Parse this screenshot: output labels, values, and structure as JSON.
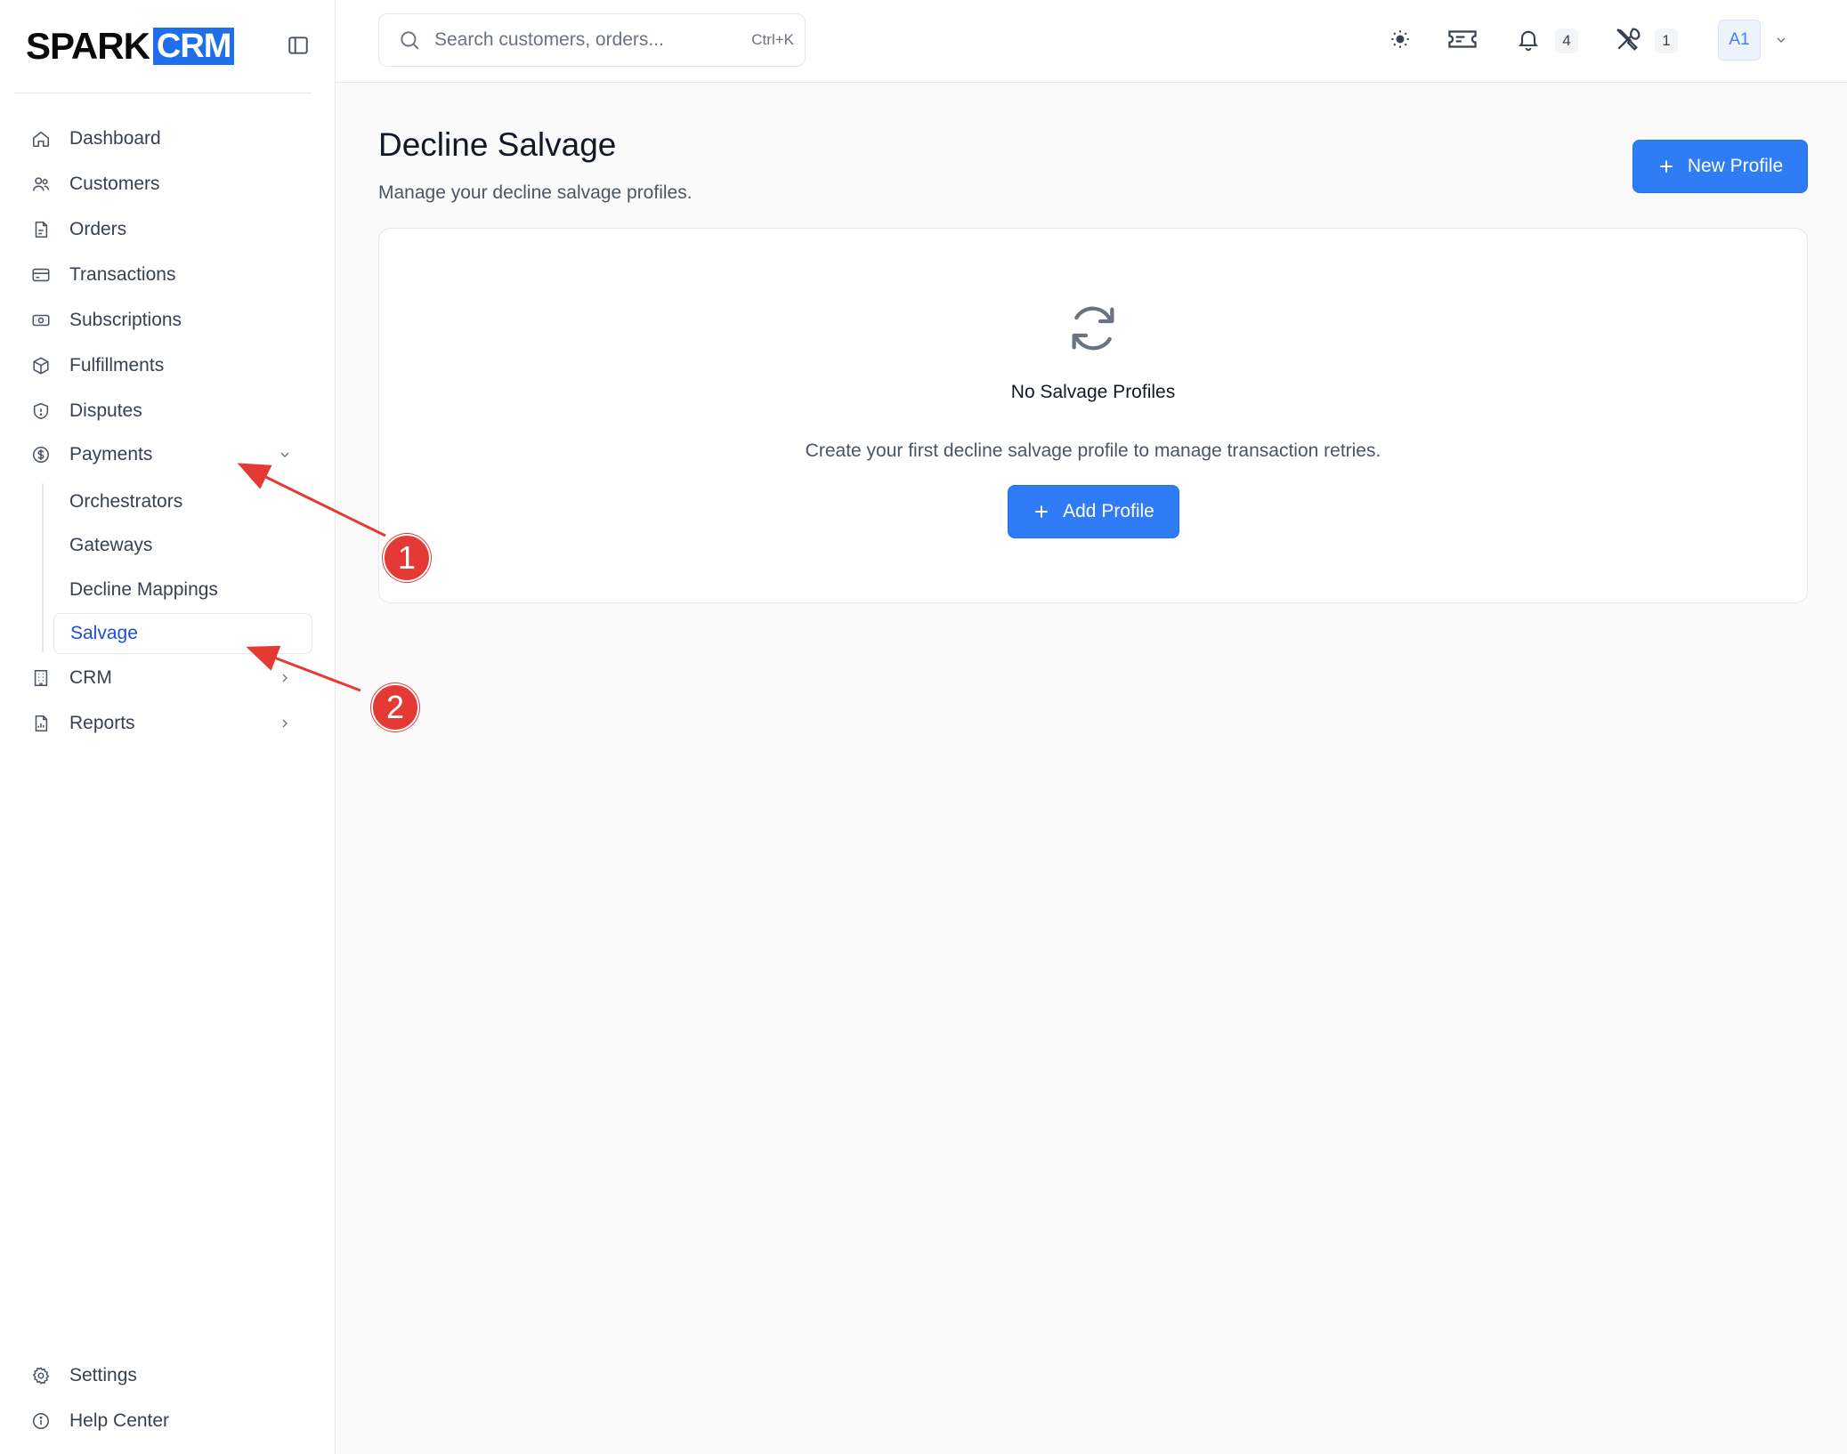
{
  "brand": {
    "part1": "SPARK",
    "part2": "CRM"
  },
  "sidebar": {
    "items": [
      {
        "label": "Dashboard",
        "icon": "home-icon"
      },
      {
        "label": "Customers",
        "icon": "users-icon"
      },
      {
        "label": "Orders",
        "icon": "file-icon"
      },
      {
        "label": "Transactions",
        "icon": "credit-card-icon"
      },
      {
        "label": "Subscriptions",
        "icon": "banknote-icon"
      },
      {
        "label": "Fulfillments",
        "icon": "package-icon"
      },
      {
        "label": "Disputes",
        "icon": "shield-icon"
      },
      {
        "label": "Payments",
        "icon": "dollar-circle-icon",
        "expanded": true
      },
      {
        "label": "CRM",
        "icon": "building-icon"
      },
      {
        "label": "Reports",
        "icon": "report-file-icon"
      }
    ],
    "payments_sub": [
      "Orchestrators",
      "Gateways",
      "Decline Mappings",
      "Salvage"
    ],
    "active_sub": "Salvage",
    "bottom": [
      {
        "label": "Settings",
        "icon": "gear-icon"
      },
      {
        "label": "Help Center",
        "icon": "info-icon"
      }
    ]
  },
  "topbar": {
    "search_placeholder": "Search customers, orders...",
    "search_shortcut": "Ctrl+K",
    "notifications_count": "4",
    "tools_count": "1",
    "avatar_initials": "A1"
  },
  "main": {
    "title": "Decline Salvage",
    "subtitle": "Manage your decline salvage profiles.",
    "new_button": "New Profile",
    "empty_title": "No Salvage Profiles",
    "empty_desc": "Create your first decline salvage profile to manage transaction retries.",
    "add_button": "Add Profile"
  },
  "annotations": [
    "1",
    "2"
  ],
  "colors": {
    "accent": "#2f7cf6",
    "active_text": "#1d4ed8",
    "marker": "#e53935"
  }
}
